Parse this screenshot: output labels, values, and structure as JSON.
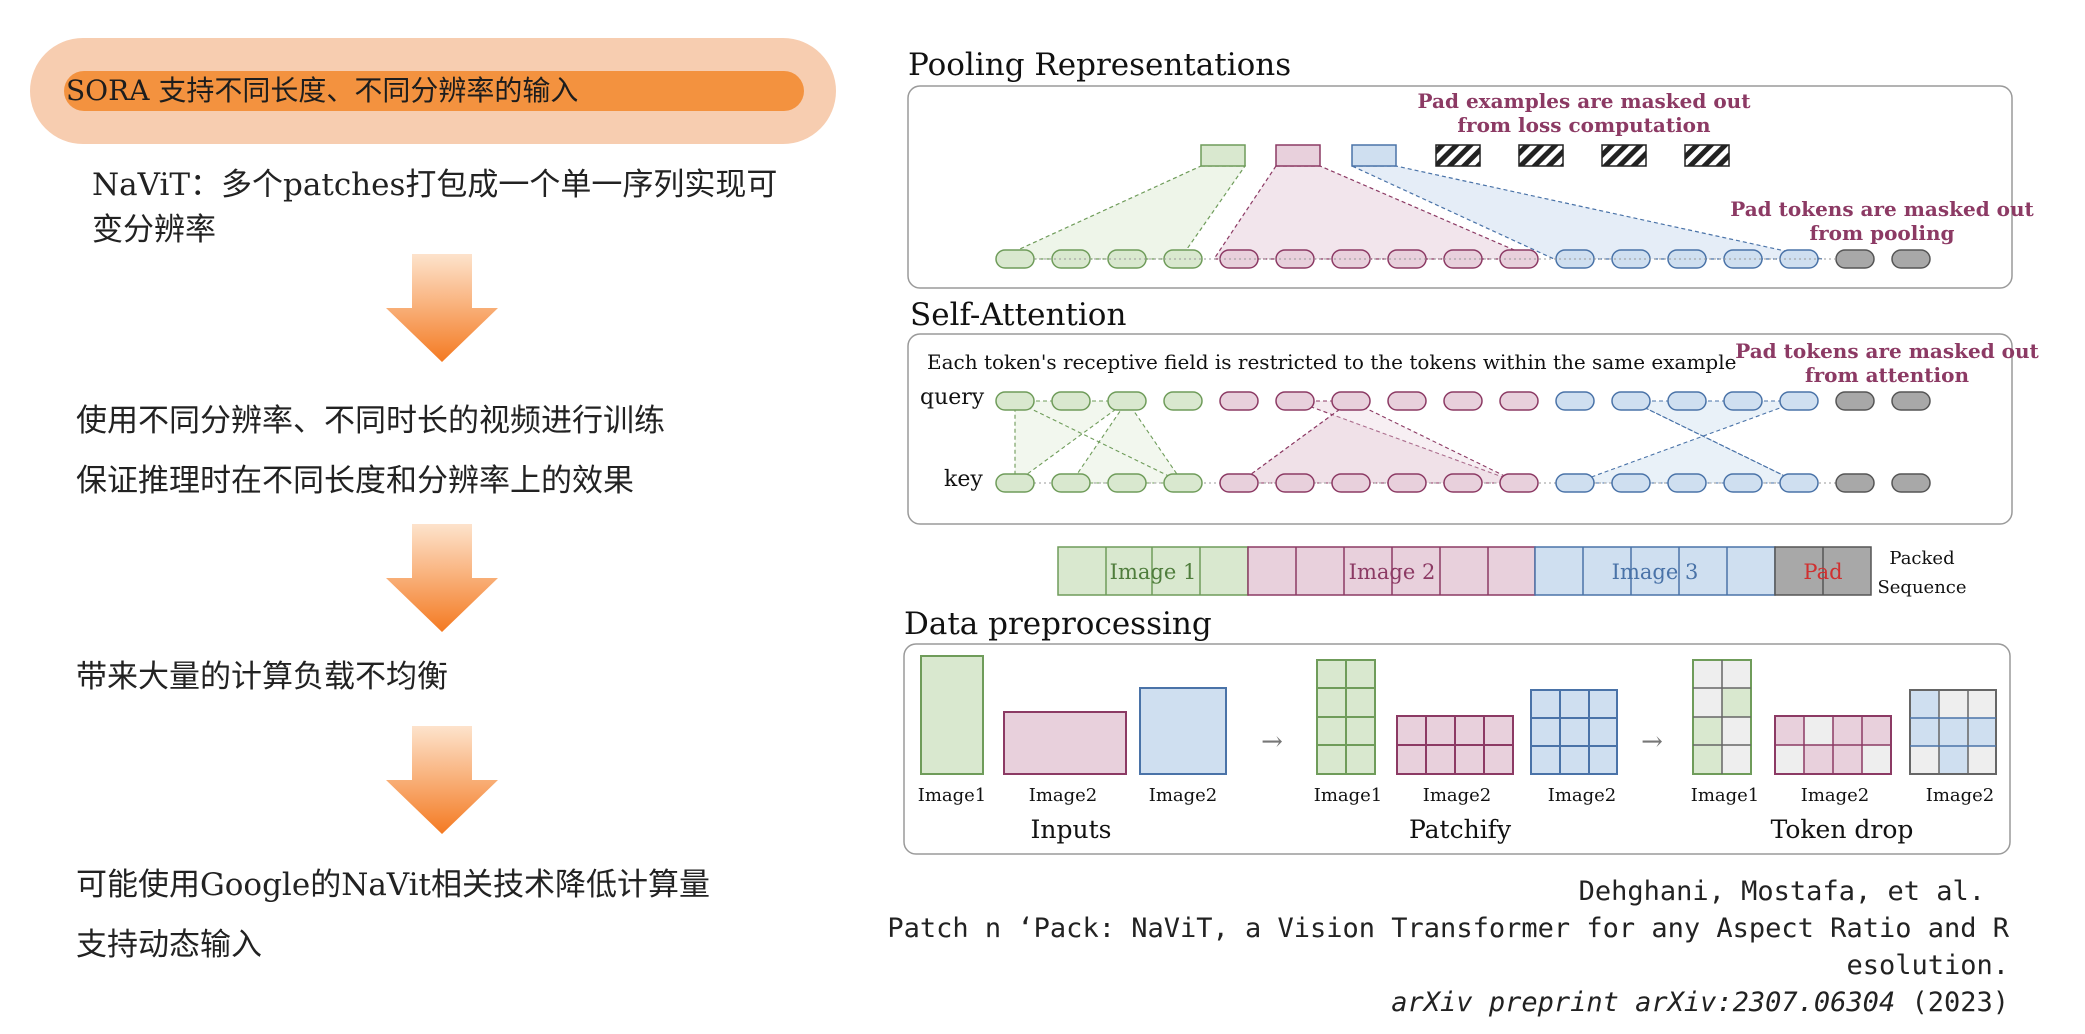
{
  "left": {
    "title": "SORA 支持不同长度、不同分辨率的输入",
    "navit_line1": "NaViT：多个patches打包成一个单一序列实现可",
    "navit_line2": "变分辨率",
    "step1_line1": "使用不同分辨率、不同时长的视频进行训练",
    "step1_line2": "保证推理时在不同长度和分辨率上的效果",
    "step2": "带来大量的计算负载不均衡",
    "step3_line1": "可能使用Google的NaVit相关技术降低计算量",
    "step3_line2": "支持动态输入"
  },
  "diagram": {
    "pooling_title": "Pooling Representations",
    "pad_examples_l1": "Pad examples are masked out",
    "pad_examples_l2": "from loss computation",
    "pad_pooling_l1": "Pad tokens are masked out",
    "pad_pooling_l2": "from pooling",
    "attention_title": "Self-Attention",
    "receptive_note": "Each token's receptive field is restricted to the tokens within the same example",
    "pad_attention_l1": "Pad tokens are masked out",
    "pad_attention_l2": "from attention",
    "query_label": "query",
    "key_label": "key",
    "seq_image1": "Image 1",
    "seq_image2": "Image 2",
    "seq_image3": "Image 3",
    "seq_pad": "Pad",
    "packed_l1": "Packed",
    "packed_l2": "Sequence",
    "preprocessing_title": "Data preprocessing",
    "inputs_labels": [
      "Image1",
      "Image2",
      "Image2"
    ],
    "patchify_labels": [
      "Image1",
      "Image2",
      "Image2"
    ],
    "tokendrop_labels": [
      "Image1",
      "Image2",
      "Image2"
    ],
    "group_inputs": "Inputs",
    "group_patchify": "Patchify",
    "group_tokendrop": "Token drop",
    "arrow_glyph": "→",
    "colors": {
      "green": "#6f9c5a",
      "green_fill": "#d9e8cf",
      "pink": "#8c3a64",
      "pink_fill": "#e8d0dc",
      "blue": "#4a73a8",
      "blue_fill": "#cfdff0",
      "pad_text": "#8c3a64",
      "pad_red": "#d03030"
    }
  },
  "citation": {
    "line1": "Dehghani, Mostafa, et al.",
    "line2": "Patch n ‘Pack: NaViT, a Vision Transformer for any Aspect Ratio and R",
    "line3": "esolution.",
    "line4_italic": "arXiv preprint arXiv:2307.06304",
    "line4_year": " (2023)"
  }
}
